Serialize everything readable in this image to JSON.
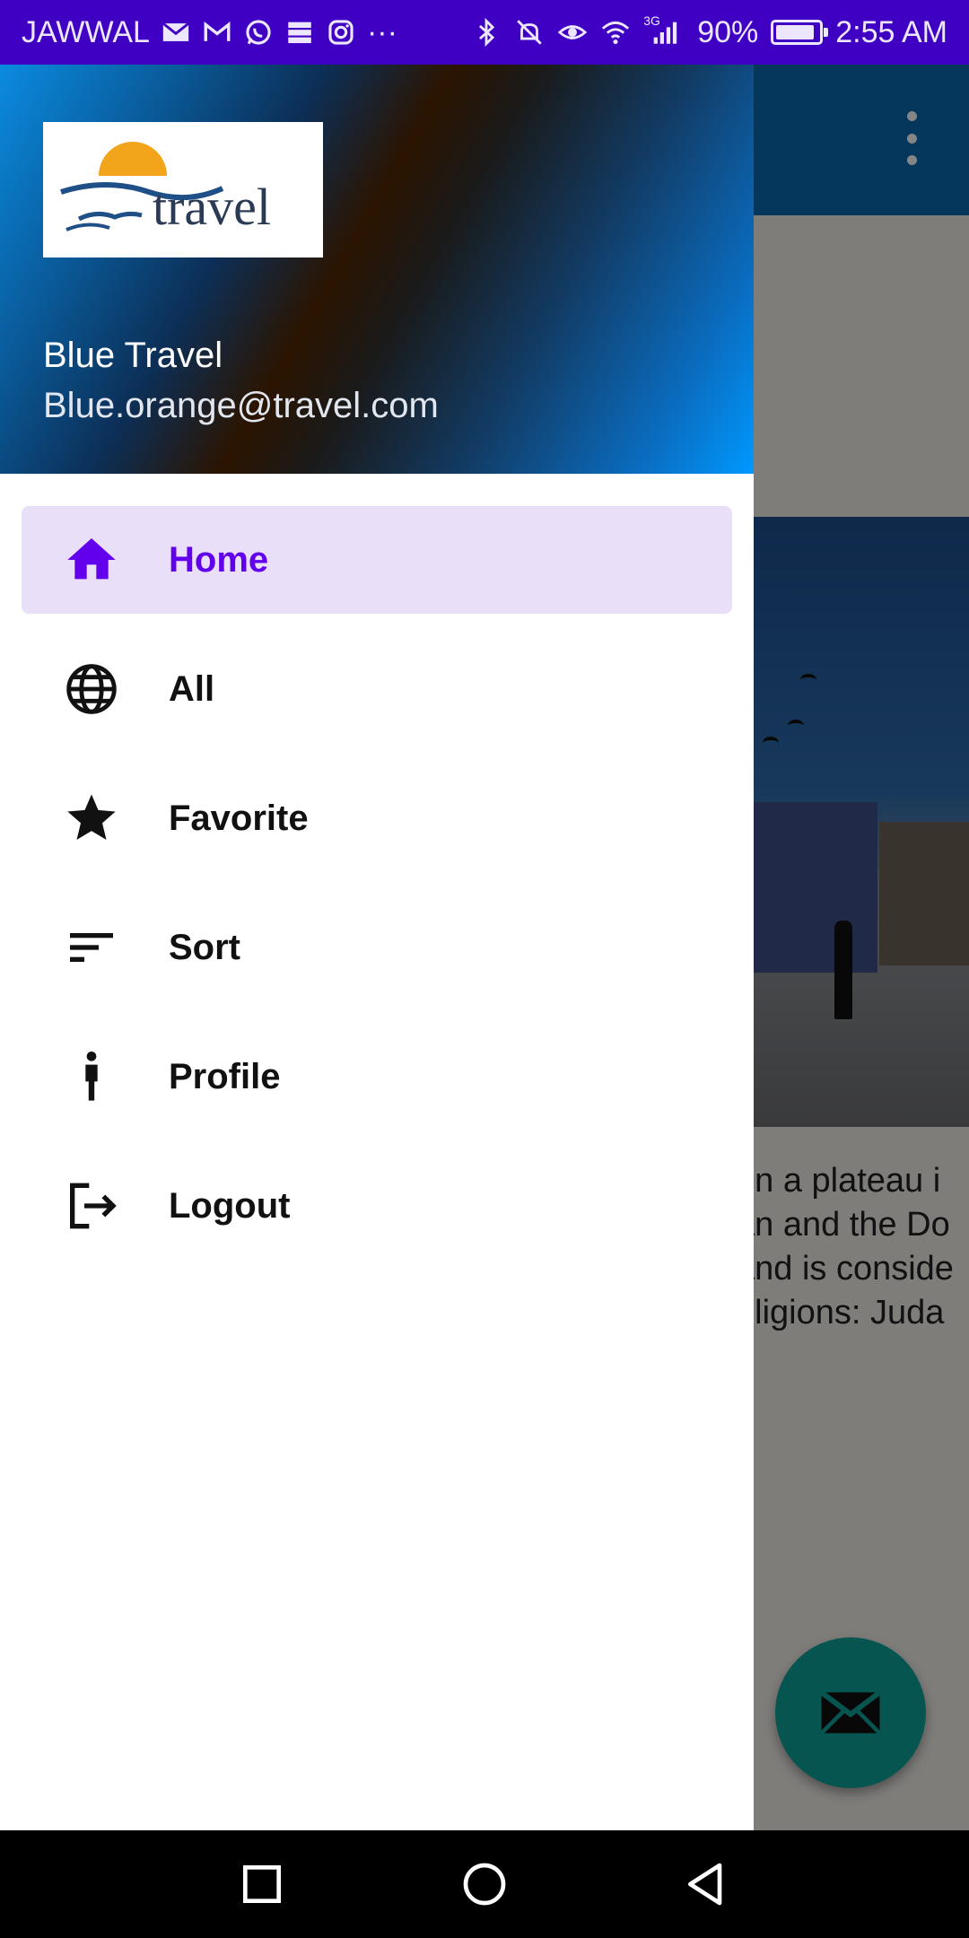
{
  "status_bar": {
    "carrier": "JAWWAL",
    "more": "···",
    "network_type": "3G",
    "battery_percent": "90%",
    "battery_level": 0.9,
    "time": "2:55 AM",
    "left_icons": [
      "mail-icon",
      "gmail-icon",
      "whatsapp-icon",
      "storage-icon",
      "instagram-icon"
    ],
    "right_icons": [
      "bluetooth-icon",
      "mute-icon",
      "eye-comfort-icon",
      "wifi-icon",
      "signal-icon",
      "battery-icon"
    ]
  },
  "background": {
    "toolbar_icon": "more-vertical-icon",
    "text_lines": [
      "on a plateau i",
      "an and the Do",
      "and is conside",
      "eligions: Juda"
    ],
    "fab_icon": "mail-icon"
  },
  "drawer": {
    "header": {
      "logo_text": "travel",
      "name": "Blue Travel",
      "email": "Blue.orange@travel.com"
    },
    "items": [
      {
        "label": "Home",
        "icon": "home-icon",
        "active": true
      },
      {
        "label": "All",
        "icon": "globe-icon",
        "active": false
      },
      {
        "label": "Favorite",
        "icon": "star-icon",
        "active": false
      },
      {
        "label": "Sort",
        "icon": "sort-icon",
        "active": false
      },
      {
        "label": "Profile",
        "icon": "person-icon",
        "active": false
      },
      {
        "label": "Logout",
        "icon": "logout-icon",
        "active": false
      }
    ]
  },
  "colors": {
    "status_bar": "#3F00C3",
    "accent": "#6200EE",
    "active_item_bg": "#EADFF9",
    "fab": "#0FA49B"
  },
  "navigation_bar": [
    "recent-apps-icon",
    "home-circle-icon",
    "back-icon"
  ]
}
